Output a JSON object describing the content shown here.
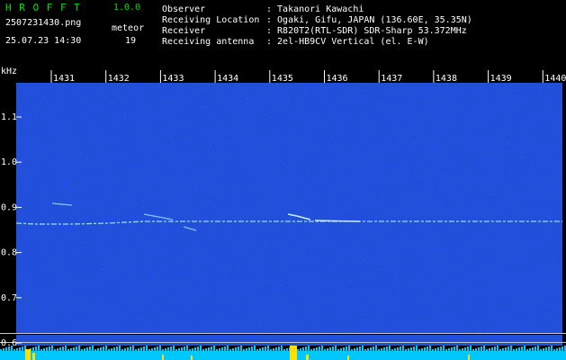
{
  "header": {
    "app_name": "H R O F F T",
    "version": "1.0.0",
    "filename": "2507231430.png",
    "datetime": "25.07.23 14:30",
    "detection_label": "meteor",
    "detection_count": "19",
    "info_rows": [
      {
        "label": "Observer",
        "value": ": Takanori Kawachi"
      },
      {
        "label": "Receiving Location",
        "value": ": Ogaki, Gifu, JAPAN (136.60E, 35.35N)"
      },
      {
        "label": "Receiver",
        "value": ": R820T2(RTL-SDR) SDR-Sharp 53.372MHz"
      },
      {
        "label": "Receiving antenna",
        "value": ": 2el-HB9CV Vertical (el. E-W)"
      }
    ]
  },
  "axes": {
    "y_unit": "kHz",
    "x_ticks": [
      "1431",
      "1432",
      "1433",
      "1434",
      "1435",
      "1436",
      "1437",
      "1438",
      "1439",
      "1440"
    ],
    "y_ticks": [
      "1.1",
      "1.0",
      "0.9",
      "0.8",
      "0.7",
      "0.6"
    ]
  },
  "colors": {
    "background": "#000000",
    "noise_base": "#0a1a8a",
    "carrier": "#a8e8ff",
    "activity_fill": "#00c8ff",
    "activity_peak": "#ffe000",
    "label_green": "#00e000"
  }
}
